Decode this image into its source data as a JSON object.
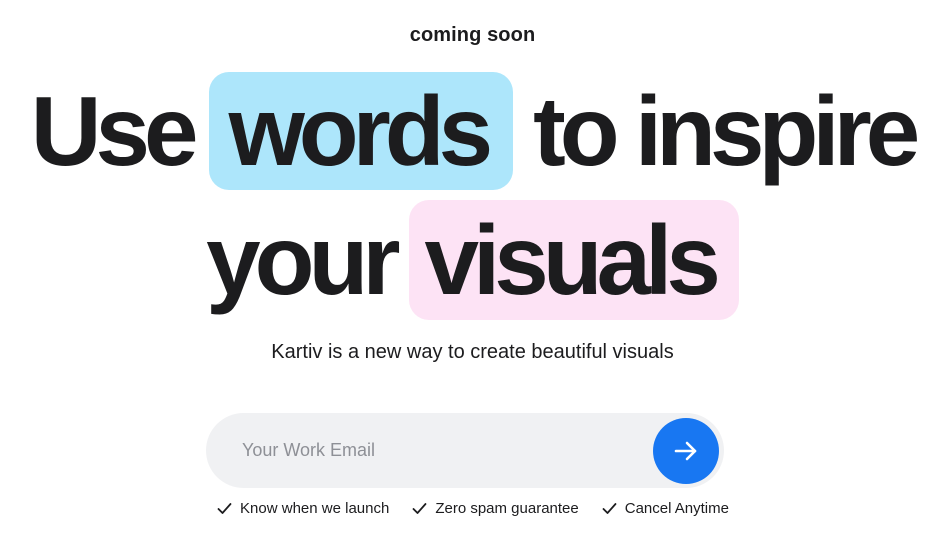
{
  "hero": {
    "eyebrow": "coming soon",
    "line1": {
      "before": "Use",
      "highlight": "words",
      "after": "to inspire"
    },
    "line2": {
      "before": "your",
      "highlight": "visuals"
    },
    "subtitle": "Kartiv is a new way to create beautiful visuals"
  },
  "signup": {
    "email_placeholder": "Your Work Email",
    "email_value": "",
    "submit_icon": "arrow-right-icon"
  },
  "features": [
    {
      "label": "Know when we launch",
      "icon": "check-icon"
    },
    {
      "label": "Zero spam guarantee",
      "icon": "check-icon"
    },
    {
      "label": "Cancel Anytime",
      "icon": "check-icon"
    }
  ],
  "colors": {
    "highlight_blue": "#ade6fb",
    "highlight_pink": "#fde3f5",
    "accent": "#1877f2",
    "text": "#1c1c1e",
    "input_bg": "#f0f1f3"
  }
}
